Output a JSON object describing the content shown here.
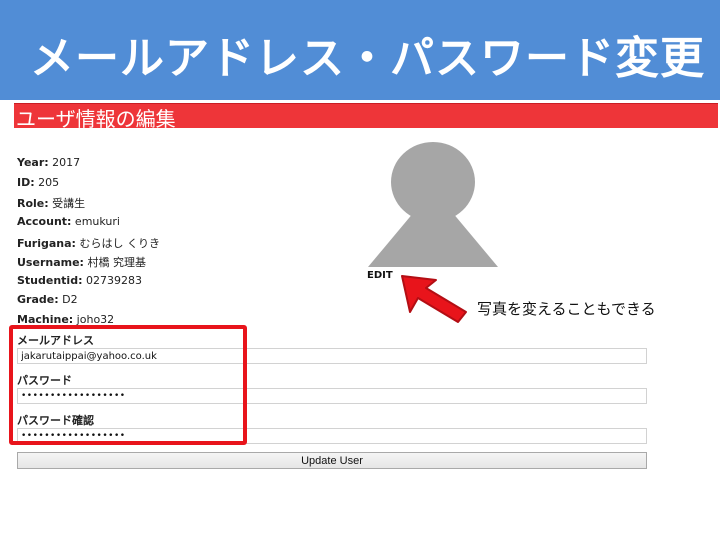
{
  "slide": {
    "title": "メールアドレス・パスワード変更",
    "header_color": "#518dd6",
    "accent_color": "#ee3539"
  },
  "section": {
    "title": "ユーザ情報の編集"
  },
  "user_info": [
    {
      "label": "Year:",
      "value": " 2017"
    },
    {
      "label": "ID:",
      "value": " 205"
    },
    {
      "label": "Role:",
      "value": " 受講生"
    },
    {
      "label": "Account:",
      "value": " emukuri"
    },
    {
      "label": "Furigana:",
      "value": " むらはし くりき"
    },
    {
      "label": "Username:",
      "value": " 村橋 究理基"
    },
    {
      "label": "Studentid:",
      "value": " 02739283"
    },
    {
      "label": "Grade:",
      "value": " D2"
    },
    {
      "label": "Machine:",
      "value": " joho32"
    }
  ],
  "avatar": {
    "icon": "default-user-avatar-icon",
    "edit_label": "EDIT"
  },
  "callout": {
    "text": "写真を変えることもできる"
  },
  "form": {
    "email_label": "メールアドレス",
    "email_value": "jakarutaippai@yahoo.co.uk",
    "password_label": "パスワード",
    "password_value": "••••••••••••••••••",
    "password_confirm_label": "パスワード確認",
    "password_confirm_value": "••••••••••••••••••",
    "submit_label": "Update User"
  }
}
